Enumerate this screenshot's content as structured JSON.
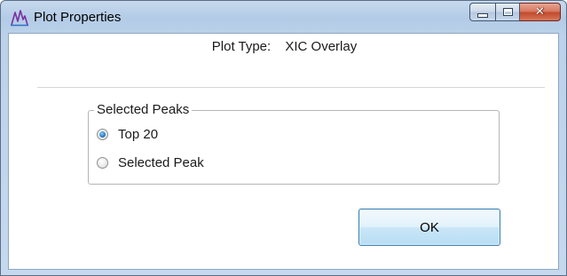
{
  "window": {
    "title": "Plot Properties",
    "app_icon": "peak-chart-icon",
    "caption_buttons": {
      "minimize": "minimize-icon",
      "maximize": "maximize-icon",
      "close": "close-icon"
    }
  },
  "plot_type": {
    "label": "Plot Type:",
    "value": "XIC Overlay"
  },
  "selected_peaks": {
    "legend": "Selected Peaks",
    "options": [
      {
        "label": "Top 20",
        "checked": true
      },
      {
        "label": "Selected Peak",
        "checked": false
      }
    ]
  },
  "buttons": {
    "ok_label": "OK"
  },
  "colors": {
    "frame": "#bcd2ea",
    "close_button": "#c24a2c",
    "radio_accent": "#2d7fc9",
    "ok_border": "#3c7fb1"
  }
}
